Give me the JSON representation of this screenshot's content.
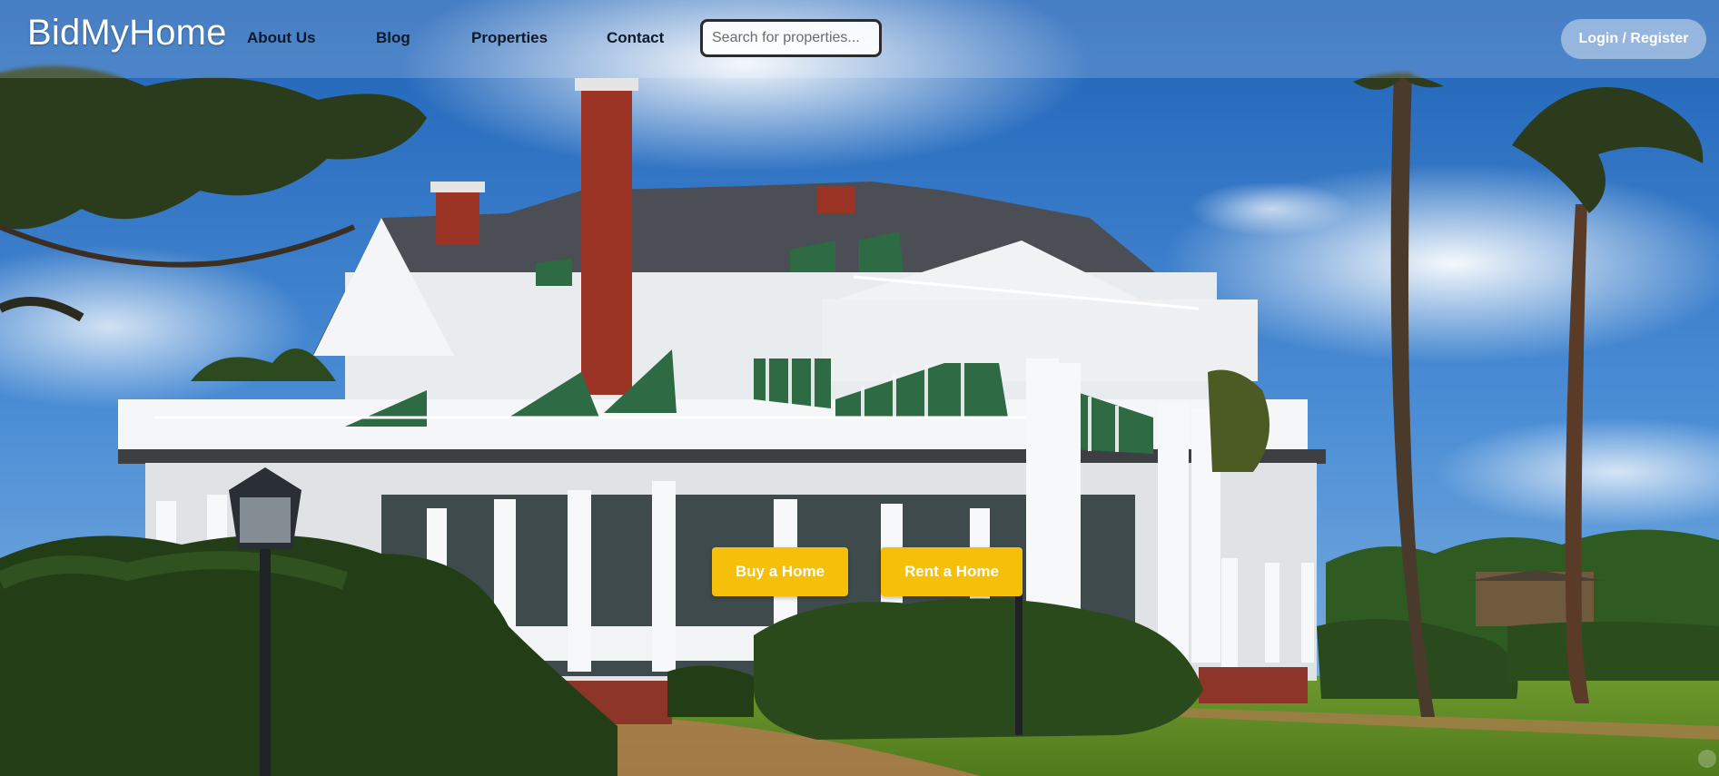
{
  "brand": {
    "name": "BidMyHome"
  },
  "nav": {
    "links": [
      {
        "label": "About Us"
      },
      {
        "label": "Blog"
      },
      {
        "label": "Properties"
      },
      {
        "label": "Contact"
      }
    ]
  },
  "search": {
    "placeholder": "Search for properties...",
    "value": ""
  },
  "account": {
    "login_label": "Login / Register"
  },
  "hero": {
    "buy_label": "Buy a Home",
    "rent_label": "Rent a Home"
  },
  "colors": {
    "accent": "#f5bf0a",
    "brand_text": "#ffffff",
    "nav_text": "#0d1a2a"
  }
}
